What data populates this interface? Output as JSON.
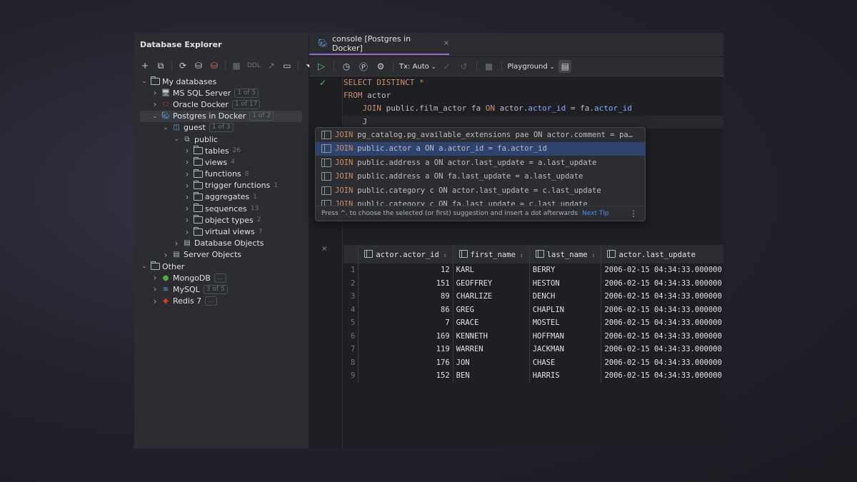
{
  "explorer": {
    "title": "Database Explorer",
    "toolbar_ddl": "DDL",
    "tree": [
      {
        "label": "My databases",
        "level": 0,
        "expanded": true,
        "icon": "folder-icon",
        "badge": ""
      },
      {
        "label": "MS SQL Server",
        "level": 1,
        "expanded": false,
        "icon": "mssql-icon",
        "badge": "1 of 5"
      },
      {
        "label": "Oracle Docker",
        "level": 1,
        "expanded": false,
        "icon": "oracle-icon",
        "badge": "1 of 17"
      },
      {
        "label": "Postgres in Docker",
        "level": 1,
        "expanded": true,
        "icon": "postgres-icon",
        "badge": "1 of 2",
        "selected": true
      },
      {
        "label": "guest",
        "level": 2,
        "expanded": true,
        "icon": "database-icon",
        "badge": "1 of 3"
      },
      {
        "label": "public",
        "level": 3,
        "expanded": true,
        "icon": "schema-icon",
        "badge": ""
      },
      {
        "label": "tables",
        "level": 4,
        "expanded": false,
        "icon": "folder-icon",
        "badge": "26"
      },
      {
        "label": "views",
        "level": 4,
        "expanded": false,
        "icon": "folder-icon",
        "badge": "4"
      },
      {
        "label": "functions",
        "level": 4,
        "expanded": false,
        "icon": "folder-icon",
        "badge": "8"
      },
      {
        "label": "trigger functions",
        "level": 4,
        "expanded": false,
        "icon": "folder-icon",
        "badge": "1"
      },
      {
        "label": "aggregates",
        "level": 4,
        "expanded": false,
        "icon": "folder-icon",
        "badge": "1"
      },
      {
        "label": "sequences",
        "level": 4,
        "expanded": false,
        "icon": "folder-icon",
        "badge": "13"
      },
      {
        "label": "object types",
        "level": 4,
        "expanded": false,
        "icon": "folder-icon",
        "badge": "2"
      },
      {
        "label": "virtual views",
        "level": 4,
        "expanded": false,
        "icon": "folder-icon",
        "badge": "7"
      },
      {
        "label": "Database Objects",
        "level": 3,
        "expanded": false,
        "icon": "db-objects-icon",
        "badge": ""
      },
      {
        "label": "Server Objects",
        "level": 2,
        "expanded": false,
        "icon": "server-objects-icon",
        "badge": ""
      },
      {
        "label": "Other",
        "level": 0,
        "expanded": true,
        "icon": "folder-icon",
        "badge": ""
      },
      {
        "label": "MongoDB",
        "level": 1,
        "expanded": false,
        "icon": "mongodb-icon",
        "badge": "..."
      },
      {
        "label": "MySQL",
        "level": 1,
        "expanded": false,
        "icon": "mysql-icon",
        "badge": "3 of 5"
      },
      {
        "label": "Redis 7",
        "level": 1,
        "expanded": false,
        "icon": "redis-icon",
        "badge": "..."
      }
    ]
  },
  "tab": {
    "label": "console [Postgres in Docker]",
    "close": "×"
  },
  "toolbar": {
    "tx": "Tx: Auto",
    "playground": "Playground"
  },
  "code": {
    "l1_kw": "SELECT DISTINCT",
    "l1_rest": " *",
    "l2_kw": "FROM",
    "l2_rest": " actor",
    "l3_indent": "    ",
    "l3_kw": "JOIN",
    "l3_a": " public.film_actor fa ",
    "l3_on": "ON",
    "l3_b": " actor.",
    "l3_f1": "actor_id",
    "l3_c": " = fa.",
    "l3_f2": "actor_id",
    "l4": "    J"
  },
  "completion": {
    "items": [
      {
        "rest": "pg_catalog.pg_available_extensions pae ON actor.comment = pa…"
      },
      {
        "rest": "public.actor a ON a.actor_id = fa.actor_id",
        "selected": true
      },
      {
        "rest": "public.address a ON actor.last_update = a.last_update"
      },
      {
        "rest": "public.address a ON fa.last_update = a.last_update"
      },
      {
        "rest": "public.category c ON actor.last_update = c.last_update"
      },
      {
        "rest": "public.category c ON fa.last_update = c.last_update"
      }
    ],
    "join_kw": "JOIN",
    "footer": "Press ^. to choose the selected (or first) suggestion and insert a dot afterwards",
    "next_tip": "Next Tip"
  },
  "results": {
    "close": "×",
    "columns": [
      "actor.actor_id",
      "first_name",
      "last_name",
      "actor.last_update"
    ],
    "rows": [
      [
        "1",
        "12",
        "KARL",
        "BERRY",
        "2006-02-15 04:34:33.000000"
      ],
      [
        "2",
        "151",
        "GEOFFREY",
        "HESTON",
        "2006-02-15 04:34:33.000000"
      ],
      [
        "3",
        "89",
        "CHARLIZE",
        "DENCH",
        "2006-02-15 04:34:33.000000"
      ],
      [
        "4",
        "86",
        "GREG",
        "CHAPLIN",
        "2006-02-15 04:34:33.000000"
      ],
      [
        "5",
        "7",
        "GRACE",
        "MOSTEL",
        "2006-02-15 04:34:33.000000"
      ],
      [
        "6",
        "169",
        "KENNETH",
        "HOFFMAN",
        "2006-02-15 04:34:33.000000"
      ],
      [
        "7",
        "119",
        "WARREN",
        "JACKMAN",
        "2006-02-15 04:34:33.000000"
      ],
      [
        "8",
        "176",
        "JON",
        "CHASE",
        "2006-02-15 04:34:33.000000"
      ],
      [
        "9",
        "152",
        "BEN",
        "HARRIS",
        "2006-02-15 04:34:33.000000"
      ]
    ]
  },
  "colors": {
    "accent": "#9a6ad0",
    "keyword": "#cf8e6d",
    "field": "#9876aa",
    "selection": "#2e436e",
    "run": "#5fb865"
  }
}
